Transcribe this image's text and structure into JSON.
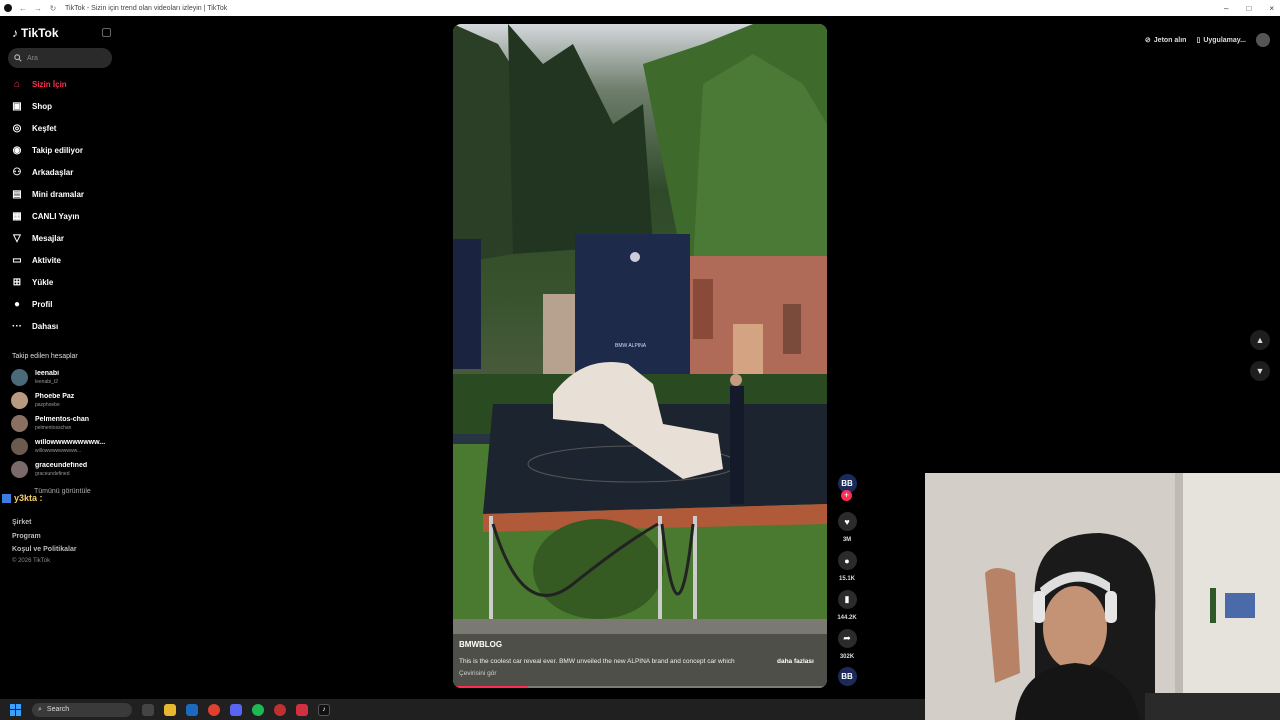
{
  "window": {
    "title": "TikTok - Sizin için trend olan videoları izleyin | TikTok",
    "controls": [
      "–",
      "□",
      "×"
    ]
  },
  "sidebar": {
    "logo": "TikTok",
    "search_placeholder": "Ara",
    "nav": [
      {
        "label": "Sizin İçin",
        "icon": "home-icon",
        "active": true
      },
      {
        "label": "Shop",
        "icon": "bag-icon"
      },
      {
        "label": "Keşfet",
        "icon": "compass-icon"
      },
      {
        "label": "Takip ediliyor",
        "icon": "following-icon"
      },
      {
        "label": "Arkadaşlar",
        "icon": "friends-icon"
      },
      {
        "label": "Mini dramalar",
        "icon": "drama-icon"
      },
      {
        "label": "CANLI Yayın",
        "icon": "live-icon"
      },
      {
        "label": "Mesajlar",
        "icon": "messages-icon"
      },
      {
        "label": "Aktivite",
        "icon": "activity-icon"
      },
      {
        "label": "Yükle",
        "icon": "upload-icon"
      },
      {
        "label": "Profil",
        "icon": "profile-icon"
      },
      {
        "label": "Dahası",
        "icon": "more-icon"
      }
    ],
    "following_title": "Takip edilen hesaplar",
    "accounts": [
      {
        "name": "leenabi",
        "username": "leenabi_t2"
      },
      {
        "name": "Phoebe Paz",
        "username": "pazphoebe"
      },
      {
        "name": "Pelmentos-chan",
        "username": "pelmentosschan"
      },
      {
        "name": "willowwwwwwwww...",
        "username": "willowwwwwwwww..."
      },
      {
        "name": "graceundefined",
        "username": "graceundefined"
      }
    ],
    "see_all": "Tümünü görüntüle",
    "overlay_text": "y3kta :",
    "footer": [
      "Şirket",
      "Program",
      "Koşul ve Politikalar"
    ],
    "copyright": "© 2026 TikTok"
  },
  "topbar": {
    "coins": "Jeton alın",
    "app": "Uygulamay..."
  },
  "video": {
    "author": "BMWBLOG",
    "description": "This is the coolest car reveal ever. BMW unveiled the new ALPINA brand and concept car which",
    "more": "daha fazlası",
    "translate": "Çevirisini gör",
    "sign_text": "BMW ALPINA",
    "progress": 0.2
  },
  "actions": {
    "author_initials": "BB",
    "likes": "3M",
    "comments": "15.1K",
    "saves": "144.2K",
    "shares": "302K"
  },
  "taskbar": {
    "search_label": "Search"
  }
}
